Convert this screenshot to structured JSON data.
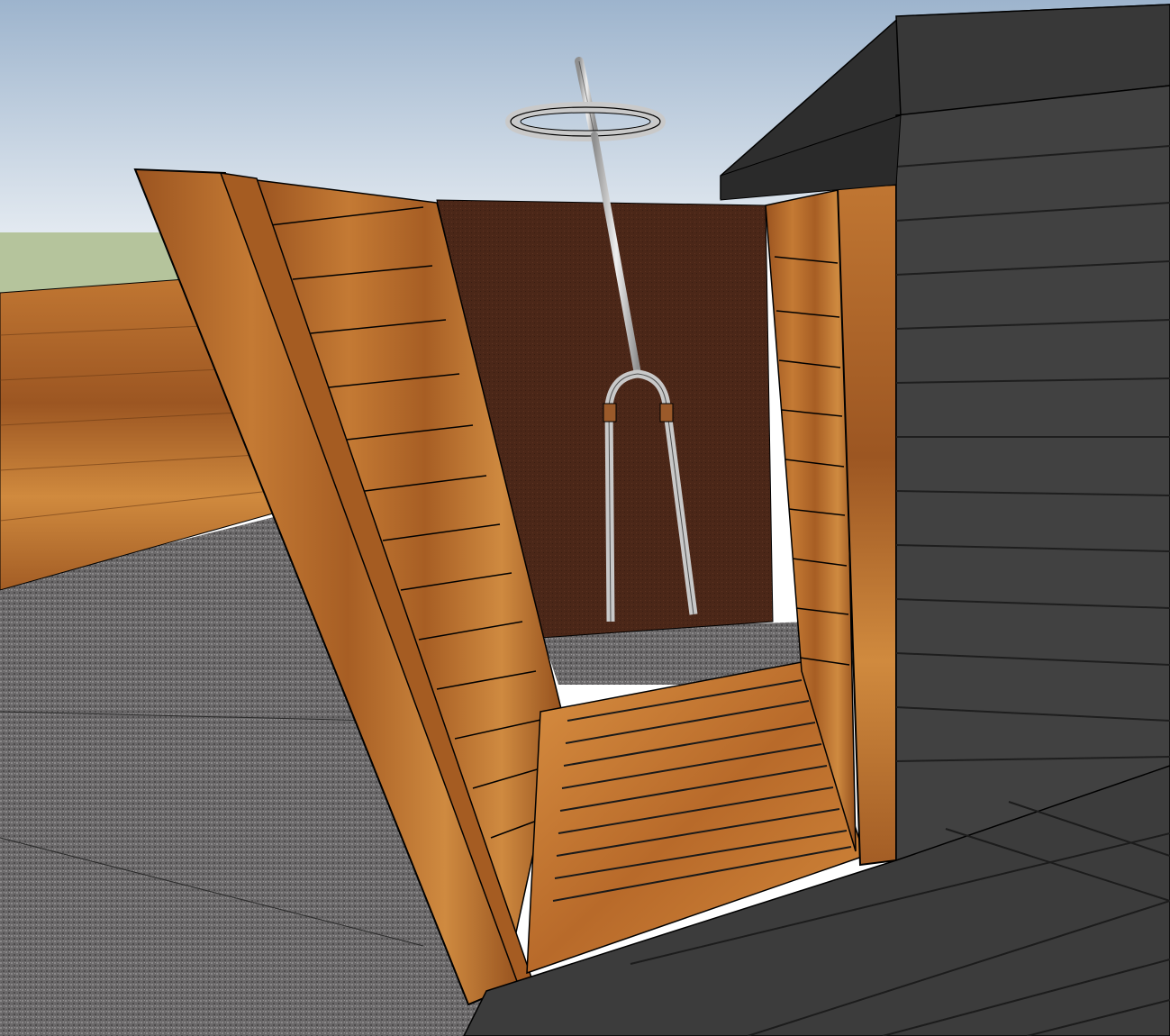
{
  "scene": {
    "subject": "outdoor-shower-enclosure-3d-model",
    "colors": {
      "sky_top": "#9fb6cf",
      "sky_bottom": "#e4ebf1",
      "grass": "#b6c59d",
      "gravel": "#6d6b6c",
      "wood_dark": "#8a4a1c",
      "wood_mid": "#b46a2c",
      "wood_light": "#d58a3c",
      "back_panel": "#4a2618",
      "siding": "#404040",
      "siding_dark": "#2e2e2e",
      "roof": "#2c2c2c",
      "pipe": "#c9c9c9",
      "outline": "#000000"
    }
  }
}
